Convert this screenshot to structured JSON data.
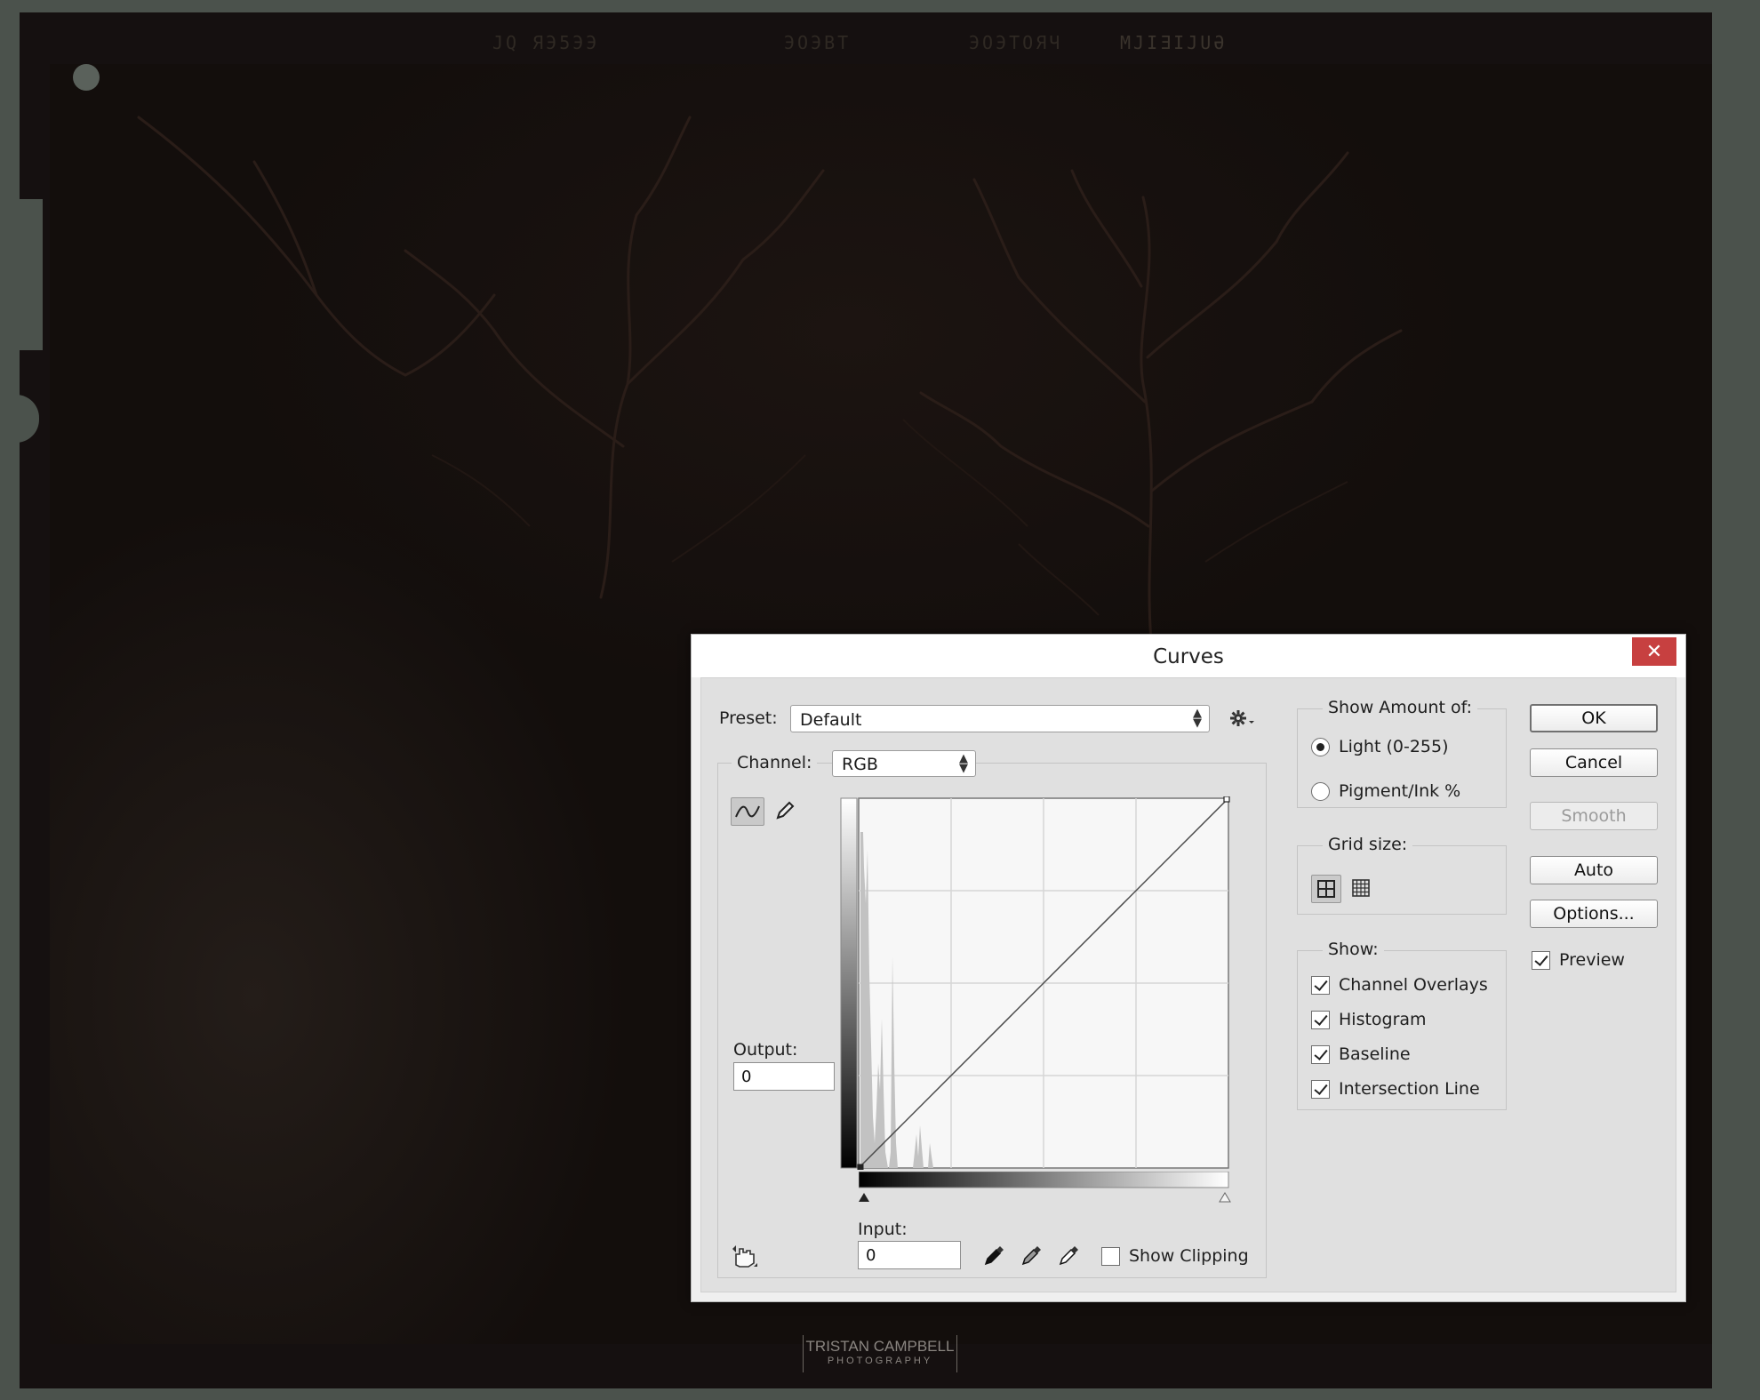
{
  "film": {
    "edge_codes": [
      "JQ  ЯЭ5ЭЭ",
      "ЭОЭВТ",
      "ЭОЭТОЯЧ",
      "MJIƎIJUӘ"
    ],
    "watermark_top": "TRISTAN CAMPBELL",
    "watermark_bottom": "PHOTOGRAPHY"
  },
  "dialog": {
    "title": "Curves",
    "close_label": "✕",
    "preset": {
      "label": "Preset:",
      "value": "Default"
    },
    "channel": {
      "label": "Channel:",
      "value": "RGB"
    },
    "output": {
      "label": "Output:",
      "value": "0"
    },
    "input": {
      "label": "Input:",
      "value": "0"
    },
    "show_clipping": {
      "label": "Show Clipping",
      "checked": false
    },
    "show_amount": {
      "title": "Show Amount of:",
      "options": [
        {
          "label": "Light  (0-255)",
          "selected": true
        },
        {
          "label": "Pigment/Ink %",
          "selected": false
        }
      ]
    },
    "grid_size": {
      "title": "Grid size:"
    },
    "show": {
      "title": "Show:",
      "options": [
        {
          "label": "Channel Overlays",
          "checked": true
        },
        {
          "label": "Histogram",
          "checked": true
        },
        {
          "label": "Baseline",
          "checked": true
        },
        {
          "label": "Intersection Line",
          "checked": true
        }
      ]
    },
    "buttons": {
      "ok": "OK",
      "cancel": "Cancel",
      "smooth": "Smooth",
      "auto": "Auto",
      "options": "Options..."
    },
    "preview": {
      "label": "Preview",
      "checked": true
    }
  },
  "colors": {
    "close": "#c74040",
    "dialog_bg": "#e0e0e0",
    "film": "#151010"
  }
}
